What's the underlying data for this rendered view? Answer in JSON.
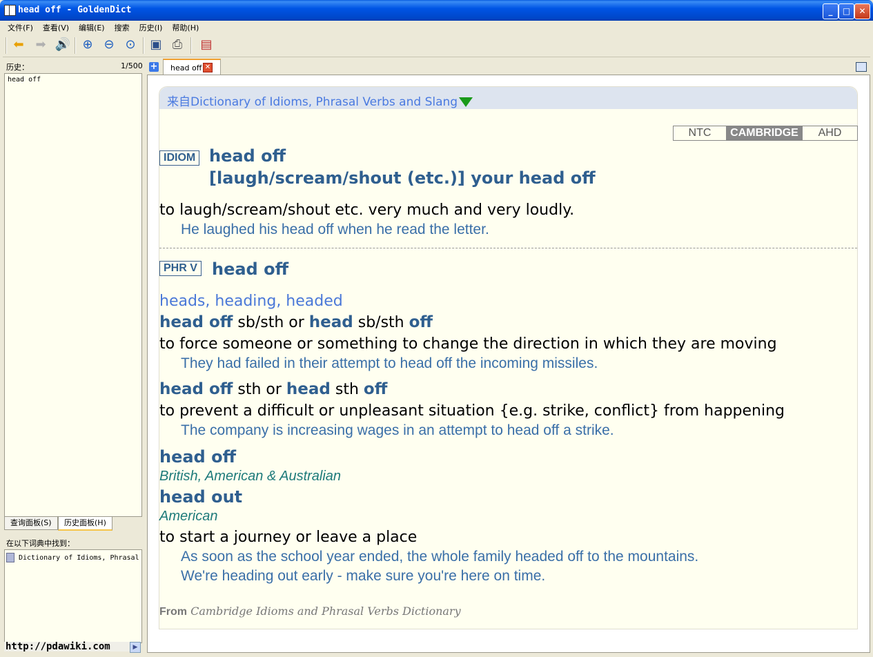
{
  "window": {
    "title": "head off - GoldenDict"
  },
  "menu": [
    "文件(F)",
    "查看(V)",
    "编辑(E)",
    "搜索",
    "历史(I)",
    "帮助(H)"
  ],
  "left": {
    "history_label": "历史：",
    "history_count": "1/500",
    "history_items": [
      "head off"
    ],
    "tab_search": "查询面板(S)",
    "tab_history": "历史面板(H)",
    "found_label": "在以下词典中找到：",
    "found_items": [
      "Dictionary of Idioms, Phrasal"
    ],
    "watermark": "http://pdawiki.com"
  },
  "tabs": {
    "current": "head off"
  },
  "article": {
    "from_text": "来自Dictionary of Idioms, Phrasal Verbs and Slang",
    "source_tabs": [
      "NTC",
      "CAMBRIDGE",
      "AHD"
    ],
    "active_source": "CAMBRIDGE",
    "idiom": {
      "tag": "IDIOM",
      "headword": "head off",
      "variant": "[laugh/scream/shout (etc.)] your head off",
      "definition": "to laugh/scream/shout etc. very much and very loudly.",
      "example": "He laughed his head off when he read the letter."
    },
    "phrv": {
      "tag": "PHR V",
      "headword": "head off",
      "forms": "heads, heading, headed",
      "senses": [
        {
          "pattern": {
            "hw1": "head off",
            "t1": " sb/sth or ",
            "hw2": "head",
            "t2": " sb/sth ",
            "hw3": "off"
          },
          "definition": "to force someone or something to change the direction in which they are moving",
          "example": "They had failed in their attempt to head off the incoming missiles."
        },
        {
          "pattern": {
            "hw1": "head off",
            "t1": " sth or ",
            "hw2": "head",
            "t2": " sth ",
            "hw3": "off"
          },
          "definition": "to prevent a difficult or unpleasant situation {e.g. strike, conflict} from happening",
          "example": "The company is increasing wages in an attempt to head off a strike."
        }
      ],
      "variants": [
        {
          "headword": "head off",
          "region": "British, American & Australian"
        },
        {
          "headword": "head out",
          "region": "American"
        }
      ],
      "final_definition": "to start a journey or leave a place",
      "final_examples": [
        "As soon as the school year ended, the whole family headed off to the mountains.",
        "We're heading out early - make sure you're here on time."
      ]
    },
    "footer_from": "From",
    "footer_source": "Cambridge Idioms and Phrasal Verbs Dictionary"
  },
  "colors": {
    "title_bar": "#0055e5",
    "headword": "#2f5f8f",
    "example": "#3a6fa8",
    "region": "#1d7a7a"
  }
}
